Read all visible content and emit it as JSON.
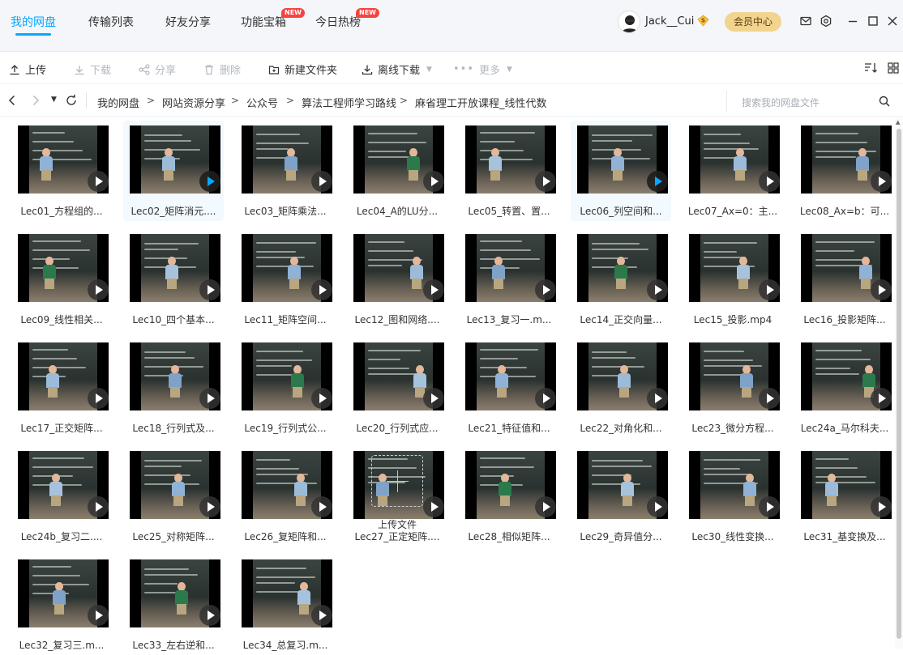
{
  "nav": {
    "tabs": [
      {
        "label": "我的网盘",
        "active": true
      },
      {
        "label": "传输列表"
      },
      {
        "label": "好友分享"
      },
      {
        "label": "功能宝箱",
        "badge": "NEW"
      },
      {
        "label": "今日热榜",
        "badge": "NEW"
      }
    ],
    "username": "Jack__Cui",
    "vip_coin": "S",
    "member_center": "会员中心"
  },
  "toolbar": {
    "upload": "上传",
    "download": "下载",
    "share": "分享",
    "delete": "删除",
    "new_folder": "新建文件夹",
    "offline_download": "离线下载",
    "more": "更多"
  },
  "address": {
    "breadcrumb": [
      "我的网盘",
      "网站资源分享",
      "公众号",
      "算法工程师学习路线",
      "麻省理工开放课程_线性代数"
    ],
    "search_placeholder": "搜索我的网盘文件"
  },
  "files": [
    {
      "name": "Lec01_方程组的..."
    },
    {
      "name": "Lec02_矩阵消元....",
      "selected": true
    },
    {
      "name": "Lec03_矩阵乘法..."
    },
    {
      "name": "Lec04_A的LU分..."
    },
    {
      "name": "Lec05_转置、置..."
    },
    {
      "name": "Lec06_列空间和...",
      "selected": true
    },
    {
      "name": "Lec07_Ax=0：主..."
    },
    {
      "name": "Lec08_Ax=b：可..."
    },
    {
      "name": "Lec09_线性相关..."
    },
    {
      "name": "Lec10_四个基本..."
    },
    {
      "name": "Lec11_矩阵空间..."
    },
    {
      "name": "Lec12_图和网络...."
    },
    {
      "name": "Lec13_复习一.m..."
    },
    {
      "name": "Lec14_正交向量..."
    },
    {
      "name": "Lec15_投影.mp4"
    },
    {
      "name": "Lec16_投影矩阵..."
    },
    {
      "name": "Lec17_正交矩阵..."
    },
    {
      "name": "Lec18_行列式及..."
    },
    {
      "name": "Lec19_行列式公..."
    },
    {
      "name": "Lec20_行列式应..."
    },
    {
      "name": "Lec21_特征值和..."
    },
    {
      "name": "Lec22_对角化和..."
    },
    {
      "name": "Lec23_微分方程..."
    },
    {
      "name": "Lec24a_马尔科夫..."
    },
    {
      "name": "Lec24b_复习二...."
    },
    {
      "name": "Lec25_对称矩阵..."
    },
    {
      "name": "Lec26_复矩阵和..."
    },
    {
      "name": "Lec27_正定矩阵...."
    },
    {
      "name": "Lec28_相似矩阵..."
    },
    {
      "name": "Lec29_奇异值分..."
    },
    {
      "name": "Lec30_线性变换..."
    },
    {
      "name": "Lec31_基变换及..."
    },
    {
      "name": "Lec32_复习三.m..."
    },
    {
      "name": "Lec33_左右逆和..."
    },
    {
      "name": "Lec34_总复习.m..."
    }
  ],
  "upload_file": "上传文件",
  "colors": {
    "accent": "#06a7ff",
    "badge": "#f5443f",
    "member": "#f3d48e"
  }
}
